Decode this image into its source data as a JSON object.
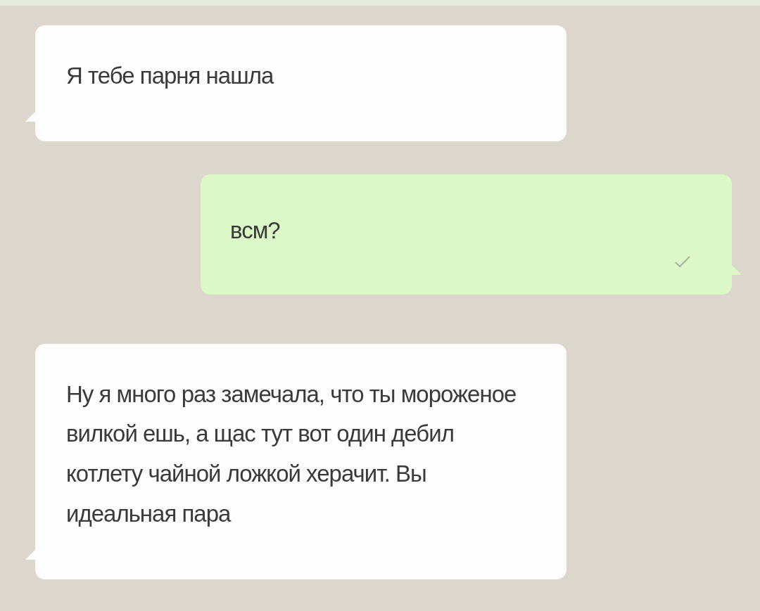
{
  "messages": [
    {
      "kind": "incoming",
      "text": "Я тебе парня нашла"
    },
    {
      "kind": "outgoing",
      "text": "всм?",
      "sent": true
    },
    {
      "kind": "incoming",
      "text": "Ну я много раз замечала, что ты мороженое вилкой ешь, а щас тут вот один дебил котлету чайной ложкой херачит. Вы идеальная пара"
    }
  ]
}
